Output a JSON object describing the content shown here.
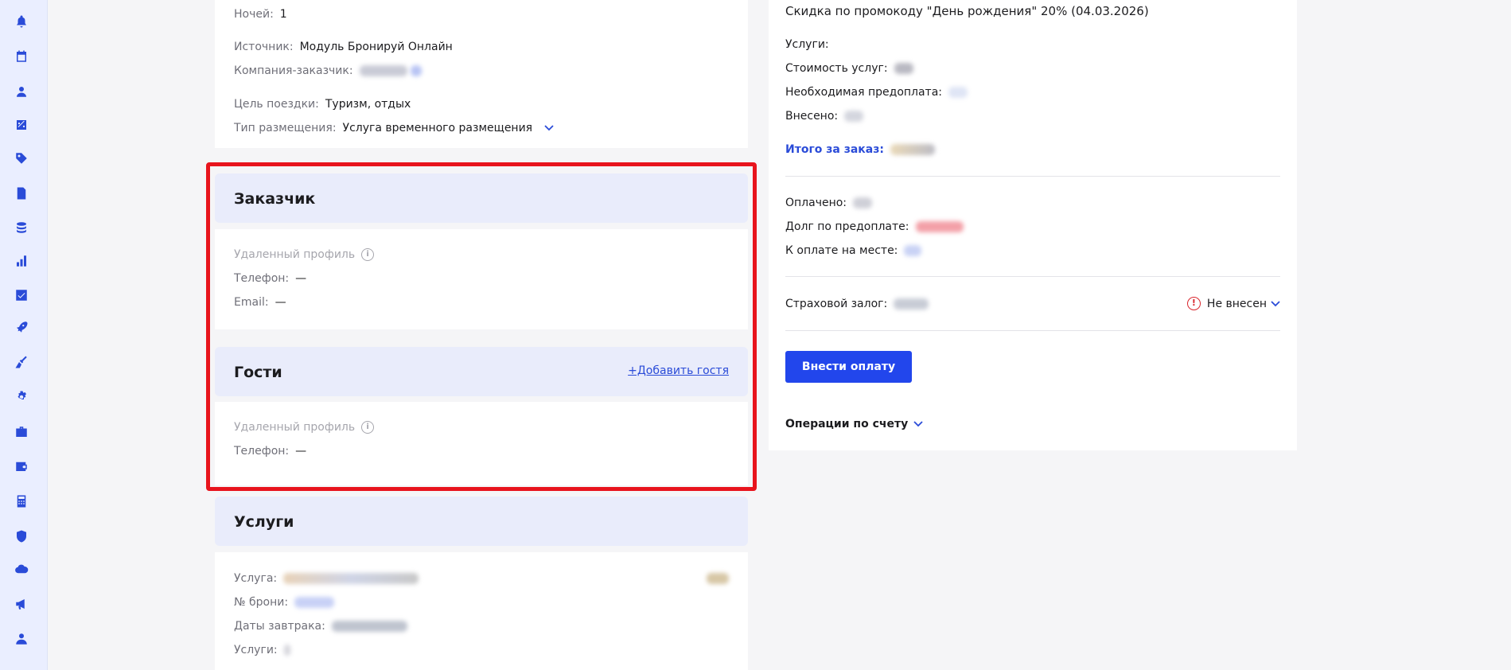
{
  "sidebar": {
    "icons": [
      "bell-icon",
      "calendar-icon",
      "user-icon",
      "percent-icon",
      "tag-icon",
      "document-icon",
      "coins-icon",
      "chart-icon",
      "checkbox-icon",
      "rocket-icon",
      "broom-icon",
      "gear-icon",
      "briefcase-icon",
      "wallet-icon",
      "calculator-icon",
      "shield-icon",
      "cloud-icon",
      "megaphone-icon",
      "profile-icon"
    ]
  },
  "booking": {
    "nights_label": "Ночей:",
    "nights_value": "1",
    "source_label": "Источник:",
    "source_value": "Модуль Бронируй Онлайн",
    "company_label": "Компания-заказчик:",
    "purpose_label": "Цель поездки:",
    "purpose_value": "Туризм, отдых",
    "accommodation_label": "Тип размещения:",
    "accommodation_value": "Услуга временного размещения"
  },
  "customer": {
    "title": "Заказчик",
    "deleted_profile": "Удаленный профиль",
    "phone_label": "Телефон:",
    "phone_value": "—",
    "email_label": "Email:",
    "email_value": "—"
  },
  "guests": {
    "title": "Гости",
    "add_link": "+Добавить гостя",
    "deleted_profile": "Удаленный профиль",
    "phone_label": "Телефон:",
    "phone_value": "—"
  },
  "services": {
    "title": "Услуги",
    "service_label": "Услуга:",
    "booking_no_label": "№ брони:",
    "breakfast_dates_label": "Даты завтрака:",
    "services_label": "Услуги:"
  },
  "payment": {
    "discount_text": "Скидка по промокоду \"День рождения\" 20% (04.03.2026)",
    "services_label": "Услуги:",
    "services_cost_label": "Стоимость услуг:",
    "prepayment_label": "Необходимая предоплата:",
    "deposited_label": "Внесено:",
    "total_label": "Итого за заказ:",
    "paid_label": "Оплачено:",
    "prepayment_debt_label": "Долг по предоплате:",
    "pay_on_site_label": "К оплате на месте:",
    "insurance_label": "Страховой залог:",
    "insurance_status": "Не внесен",
    "pay_button": "Внести оплату",
    "operations_label": "Операции по счету"
  },
  "colors": {
    "accent": "#2246ec",
    "highlight_border": "#e8141d",
    "section_bg": "#e9ecfb",
    "sidebar_bg": "#eaeeff"
  }
}
